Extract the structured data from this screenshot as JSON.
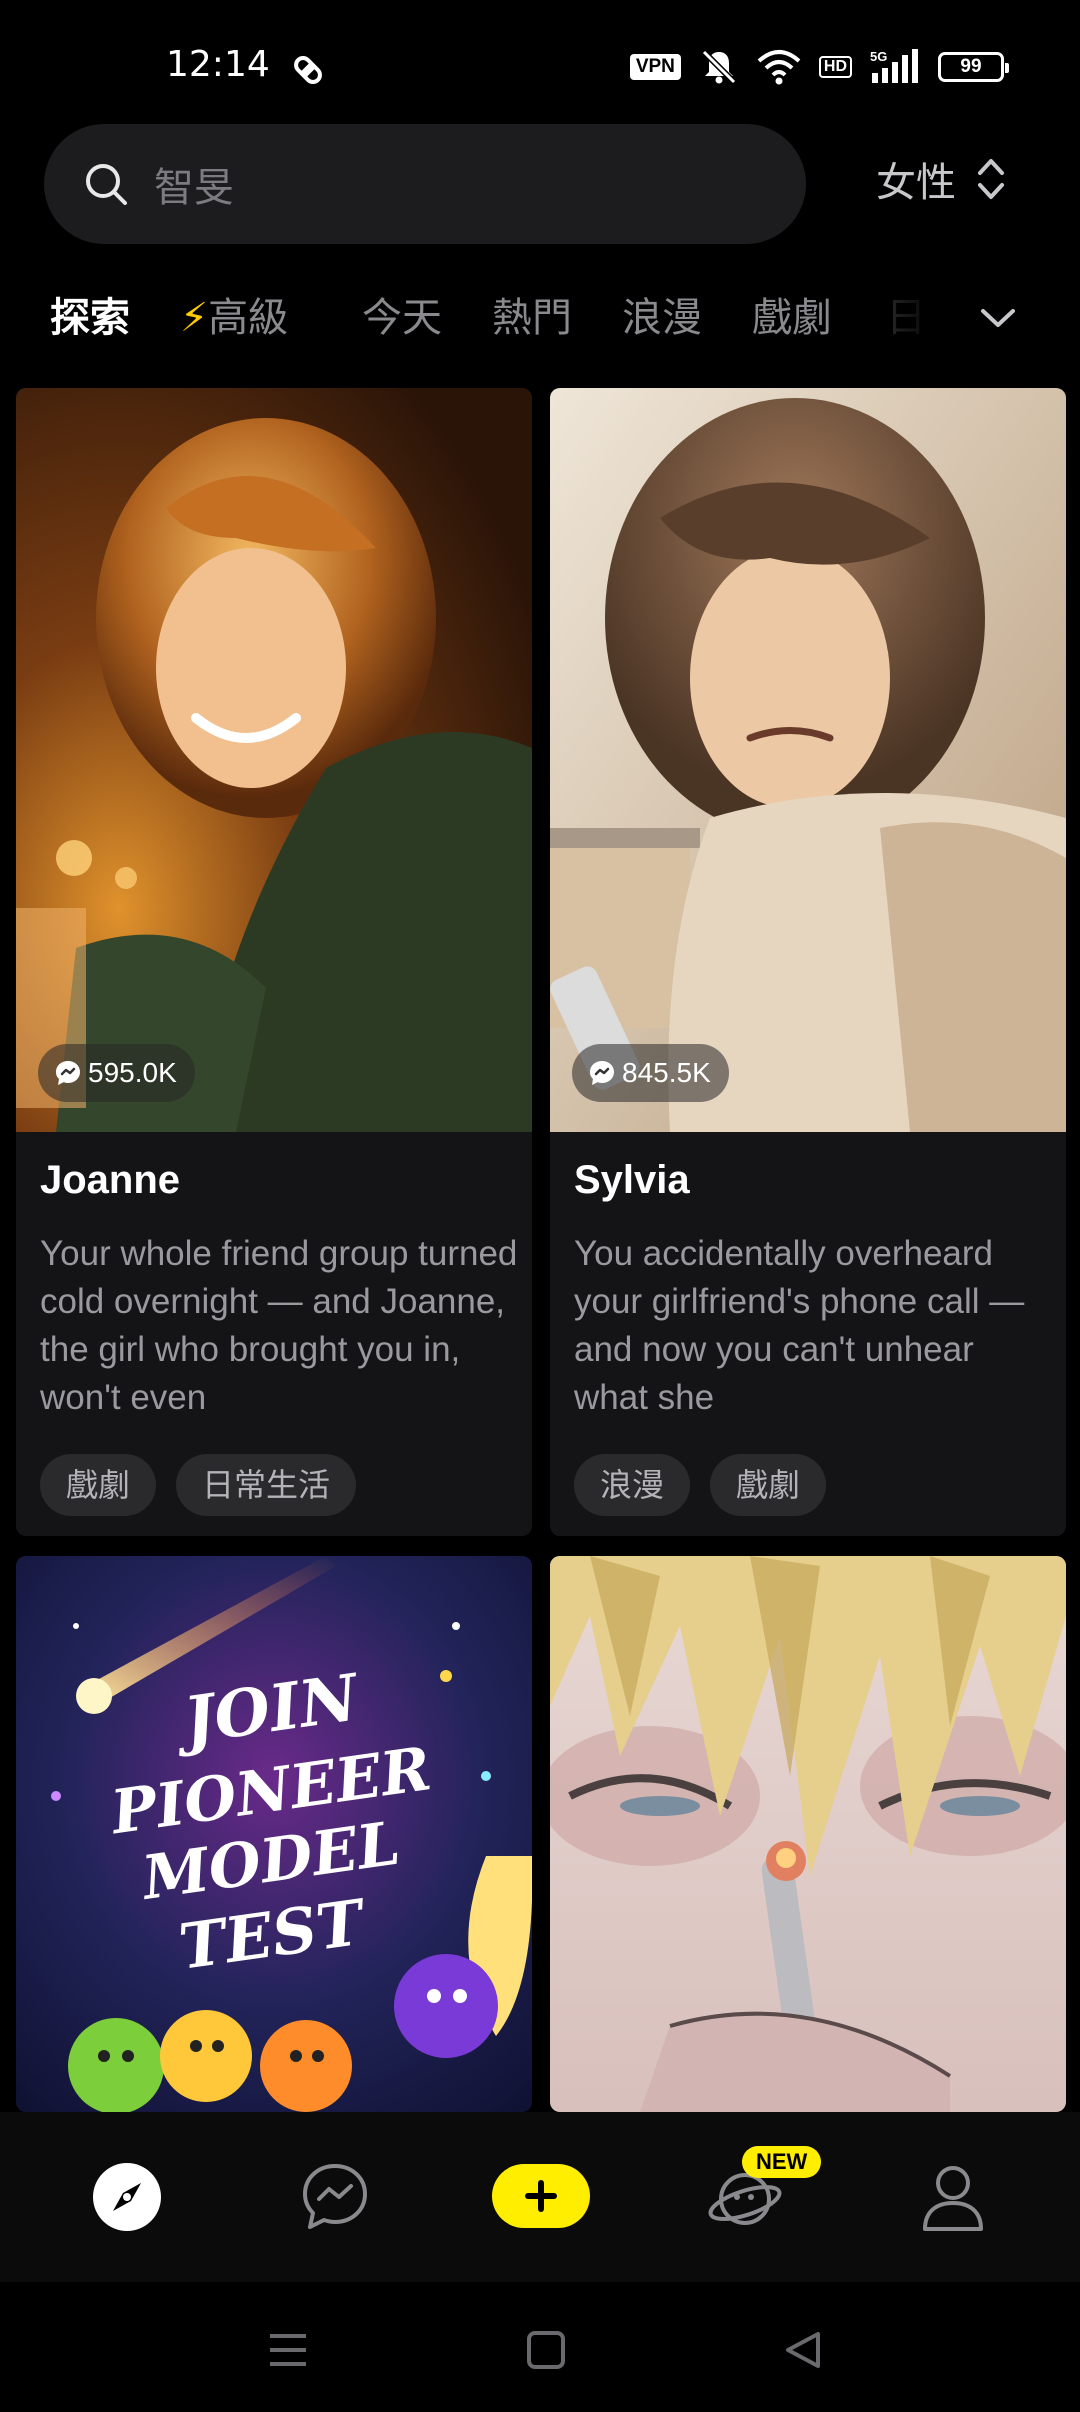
{
  "status_bar": {
    "time": "12:14",
    "vpn": "VPN",
    "hd": "HD",
    "network": "5G",
    "battery": "99"
  },
  "search": {
    "placeholder": "智旻",
    "icon": "search-icon"
  },
  "filter": {
    "gender": "女性",
    "icon": "sort-updown-icon"
  },
  "tabs": [
    {
      "label": "探索",
      "active": true
    },
    {
      "label": "⚡高級",
      "active": false
    },
    {
      "label": "今天",
      "active": false
    },
    {
      "label": "熱門",
      "active": false
    },
    {
      "label": "浪漫",
      "active": false
    },
    {
      "label": "戲劇",
      "active": false
    },
    {
      "label": "日",
      "active": false
    }
  ],
  "cards": [
    {
      "name": "Joanne",
      "chats": "595.0K",
      "description": "Your whole friend group turned cold overnight — and Joanne, the girl who brought you in, won't even",
      "tags": [
        "戲劇",
        "日常生活"
      ]
    },
    {
      "name": "Sylvia",
      "chats": "845.5K",
      "description": "You accidentally overheard your girlfriend's phone call — and now you can't unhear what she",
      "tags": [
        "浪漫",
        "戲劇"
      ]
    },
    {
      "name": "",
      "chats": "",
      "description": "",
      "tags": [],
      "image_text": "JOIN PIONEER MODEL TEST"
    },
    {
      "name": "",
      "chats": "",
      "description": "",
      "tags": []
    }
  ],
  "bottom_nav": {
    "items": [
      "explore-icon",
      "chat-icon",
      "create-icon",
      "community-icon",
      "profile-icon"
    ],
    "new_badge": "NEW",
    "accent": "#ffee00"
  },
  "system_nav": [
    "menu-icon",
    "home-icon",
    "back-icon"
  ]
}
